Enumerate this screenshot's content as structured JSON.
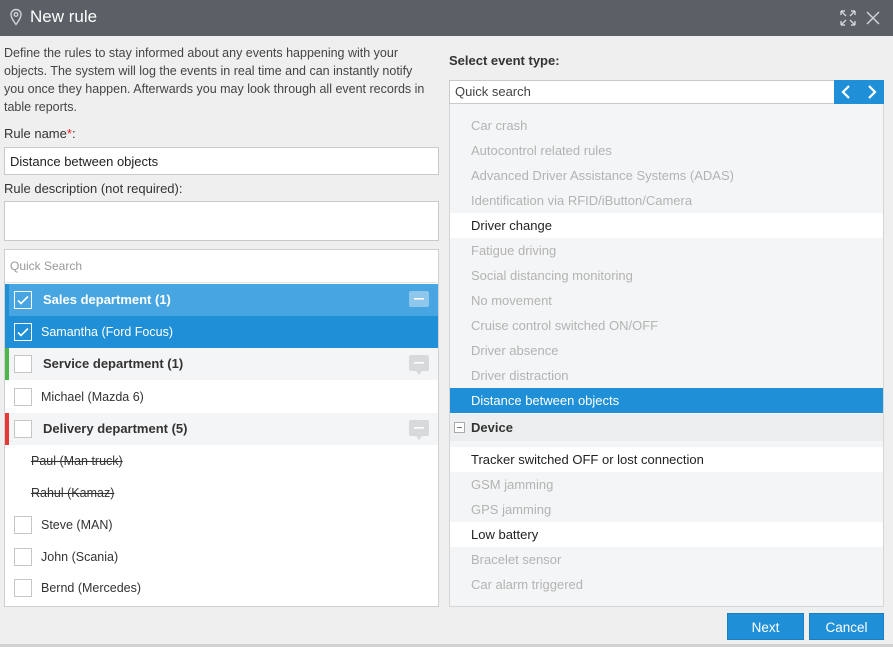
{
  "window": {
    "title": "New rule",
    "icon": "location-pin-icon"
  },
  "description": "Define the rules to stay informed about any events happening with your objects. The system will log the events in real time and can instantly notify you once they happen. Afterwards you may look through all event records in table reports.",
  "rule_name": {
    "label": "Rule name",
    "required_mark": "*",
    "colon": ":",
    "value": "Distance between objects"
  },
  "rule_description": {
    "label": "Rule description (not required):",
    "value": ""
  },
  "objects": {
    "search_placeholder": "Quick Search",
    "rows": [
      {
        "label": "Sales department (1)",
        "type": "group",
        "checked": true,
        "selected": true,
        "bar_color": "#1f8fd7"
      },
      {
        "label": "Samantha (Ford Focus)",
        "type": "item",
        "checked": true,
        "selected": true
      },
      {
        "label": "Service department (1)",
        "type": "group",
        "checked": false,
        "selected": false,
        "bar_color": "#4cb84c"
      },
      {
        "label": "Michael (Mazda 6)",
        "type": "item",
        "checked": false,
        "selected": false
      },
      {
        "label": "Delivery department (5)",
        "type": "group",
        "checked": false,
        "selected": false,
        "bar_color": "#e53935"
      },
      {
        "label": "Paul (Man truck)",
        "type": "item",
        "disabled": true
      },
      {
        "label": "Rahul (Kamaz)",
        "type": "item",
        "disabled": true
      },
      {
        "label": "Steve (MAN)",
        "type": "item",
        "checked": false,
        "selected": false
      },
      {
        "label": "John (Scania)",
        "type": "item",
        "checked": false,
        "selected": false
      },
      {
        "label": "Bernd (Mercedes)",
        "type": "item",
        "checked": false,
        "selected": false
      }
    ]
  },
  "events": {
    "title": "Select event type:",
    "search_placeholder": "Quick search",
    "items": [
      {
        "label": "Car crash",
        "state": "disabled"
      },
      {
        "label": "Autocontrol related rules",
        "state": "disabled"
      },
      {
        "label": "Advanced Driver Assistance Systems (ADAS)",
        "state": "disabled"
      },
      {
        "label": "Identification via RFID/iButton/Camera",
        "state": "disabled"
      },
      {
        "label": "Driver change",
        "state": "available"
      },
      {
        "label": "Fatigue driving",
        "state": "disabled"
      },
      {
        "label": "Social distancing monitoring",
        "state": "disabled"
      },
      {
        "label": "No movement",
        "state": "disabled"
      },
      {
        "label": "Cruise control switched ON/OFF",
        "state": "disabled"
      },
      {
        "label": "Driver absence",
        "state": "disabled"
      },
      {
        "label": "Driver distraction",
        "state": "disabled"
      },
      {
        "label": "Distance between objects",
        "state": "selected"
      },
      {
        "label": "Device",
        "state": "group"
      },
      {
        "label": "Tracker switched OFF or lost connection",
        "state": "available"
      },
      {
        "label": "GSM jamming",
        "state": "disabled"
      },
      {
        "label": "GPS jamming",
        "state": "disabled"
      },
      {
        "label": "Low battery",
        "state": "available"
      },
      {
        "label": "Bracelet sensor",
        "state": "disabled"
      },
      {
        "label": "Car alarm triggered",
        "state": "disabled"
      }
    ]
  },
  "buttons": {
    "next": "Next",
    "cancel": "Cancel"
  },
  "colors": {
    "accent": "#1f8fd7",
    "titlebar": "#5a6066"
  }
}
